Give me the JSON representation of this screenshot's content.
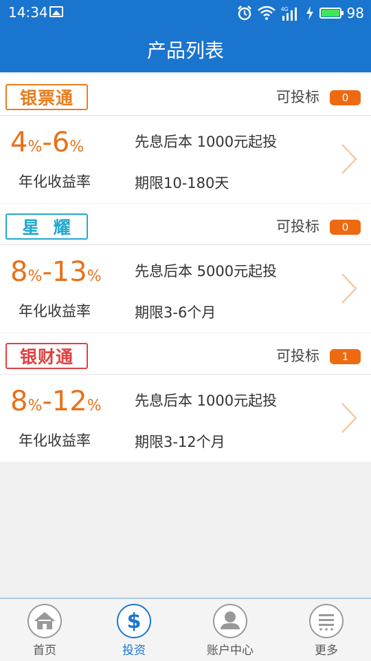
{
  "status": {
    "time": "14:34",
    "network": "4G",
    "battery": "98"
  },
  "header": {
    "title": "产品列表"
  },
  "common": {
    "available_label": "可投标",
    "rate_label": "年化收益率",
    "percent": "%",
    "dash": "-"
  },
  "products": [
    {
      "name": "银票通",
      "count": "0",
      "rate_min": "4",
      "rate_max": "6",
      "repay_min": "先息后本  1000元起投",
      "term": "期限10-180天",
      "color": "#e87d1e"
    },
    {
      "name": "星  耀",
      "count": "0",
      "rate_min": "8",
      "rate_max": "13",
      "repay_min": "先息后本  5000元起投",
      "term": "期限3-6个月",
      "color": "#22a9cc"
    },
    {
      "name": "银财通",
      "count": "1",
      "rate_min": "8",
      "rate_max": "12",
      "repay_min": "先息后本  1000元起投",
      "term": "期限3-12个月",
      "color": "#e04040"
    }
  ],
  "tabs": [
    {
      "label": "首页",
      "icon": "home-icon"
    },
    {
      "label": "投资",
      "icon": "dollar-icon",
      "active": true
    },
    {
      "label": "账户中心",
      "icon": "user-icon"
    },
    {
      "label": "更多",
      "icon": "more-icon"
    }
  ],
  "colors": {
    "primary": "#1a75cf",
    "accent": "#e8721a",
    "badge": "#ee6a12"
  }
}
